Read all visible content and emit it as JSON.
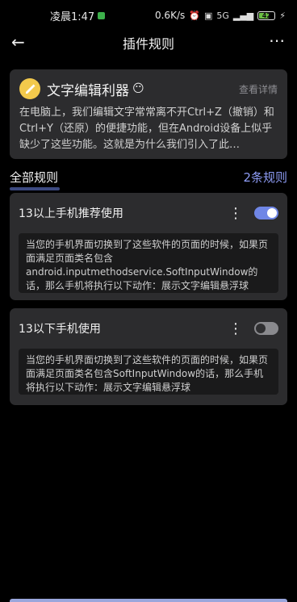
{
  "status": {
    "time": "凌晨1:47",
    "speed": "0.6K/s",
    "network": "5G",
    "battery": "42"
  },
  "header": {
    "title": "插件规则"
  },
  "plugin": {
    "name": "文字编辑利器",
    "emoji": "😶",
    "view_detail": "查看详情",
    "description": "在电脑上，我们编辑文字常常离不开Ctrl+Z（撤销）和Ctrl+Y（还原）的便捷功能，但在Android设备上似乎缺少了这些功能。这就是为什么我们引入了此…"
  },
  "rules_section": {
    "label": "全部规则",
    "count": "2条规则"
  },
  "rules": [
    {
      "title": "13以上手机推荐使用",
      "enabled": true,
      "body": "当您的手机界面切换到了这些软件的页面的时候，如果页面满足页面类名包含android.inputmethodservice.SoftInputWindow的话，那么手机将执行以下动作：展示文字编辑悬浮球"
    },
    {
      "title": "13以下手机使用",
      "enabled": false,
      "body": "当您的手机界面切换到了这些软件的页面的时候，如果页面满足页面类名包含SoftInputWindow的话，那么手机将执行以下动作：展示文字编辑悬浮球"
    }
  ],
  "colors": {
    "accent": "#6f86e6",
    "card": "#2c2c2e",
    "background": "#000000"
  }
}
